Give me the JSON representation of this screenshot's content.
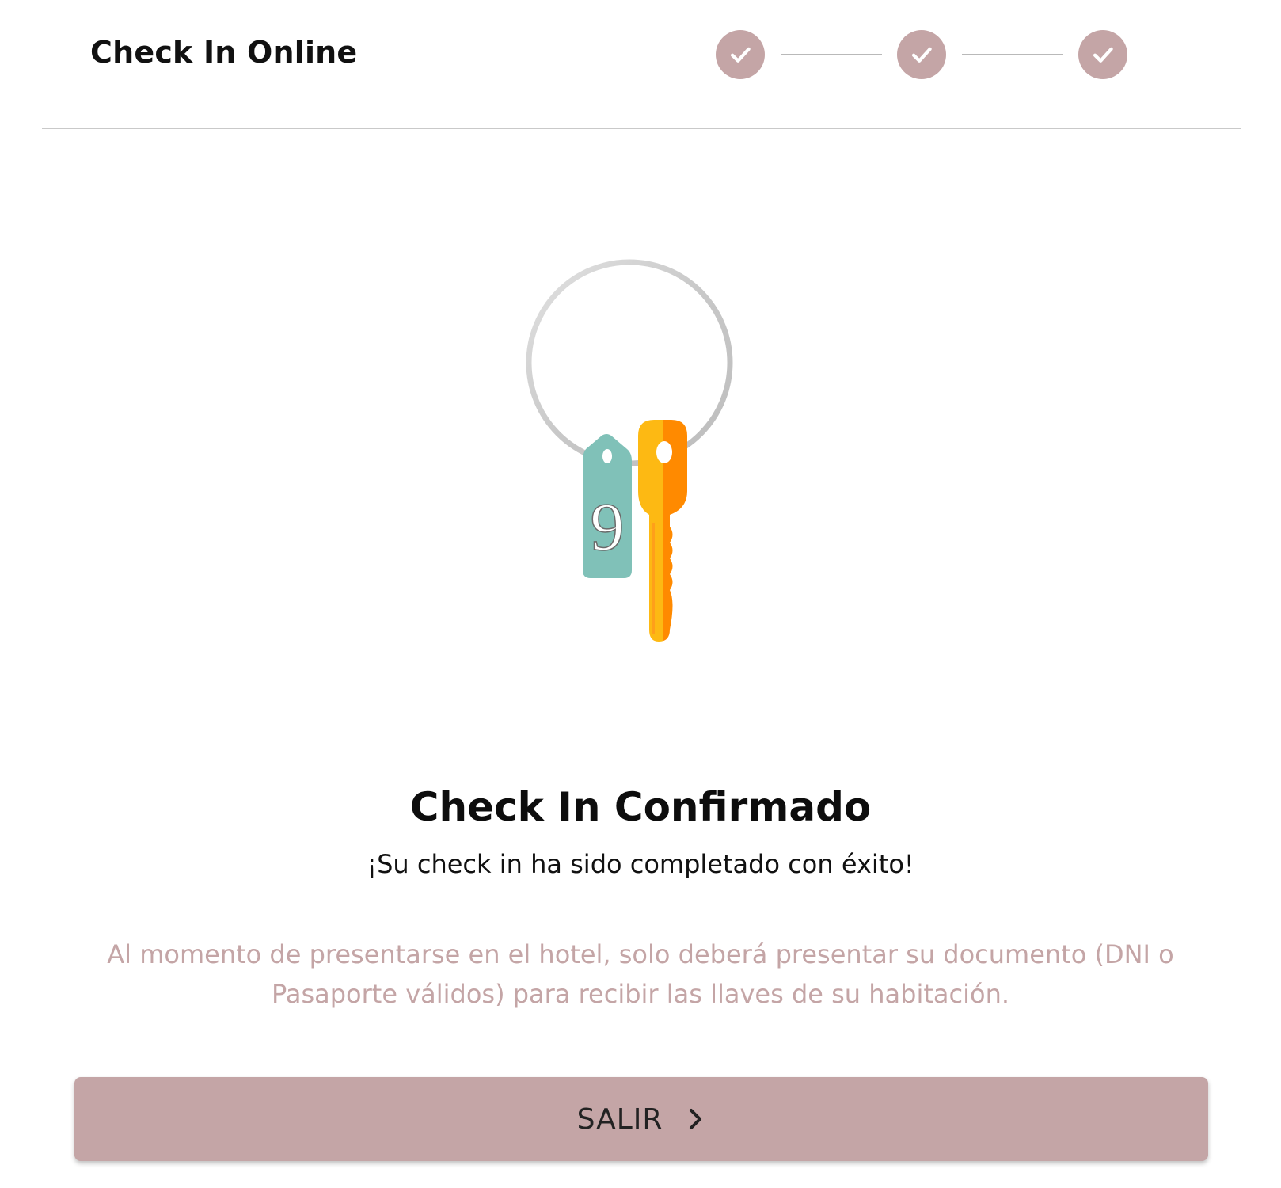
{
  "theme": {
    "accent": "#c4a5a6",
    "accent_text": "#c4a5a6",
    "key_tag": "#80c1b8",
    "key_yellow": "#fdb913",
    "key_orange": "#ff8a00",
    "ring": "#cfcfcf"
  },
  "header": {
    "title": "Check In Online",
    "steps": [
      {
        "status": "completed",
        "icon": "check-icon"
      },
      {
        "status": "completed",
        "icon": "check-icon"
      },
      {
        "status": "completed",
        "icon": "check-icon"
      }
    ]
  },
  "illustration": {
    "icon": "hotel-keys-icon",
    "tag_number": "9"
  },
  "confirmation": {
    "title": "Check In Confirmado",
    "subtitle": "¡Su check in ha sido completado con éxito!",
    "instructions": "Al momento de presentarse en el hotel, solo deberá presentar su documento (DNI o Pasaporte válidos) para recibir las llaves de su habitación."
  },
  "actions": {
    "exit_label": "SALIR",
    "exit_icon": "chevron-right-icon"
  }
}
